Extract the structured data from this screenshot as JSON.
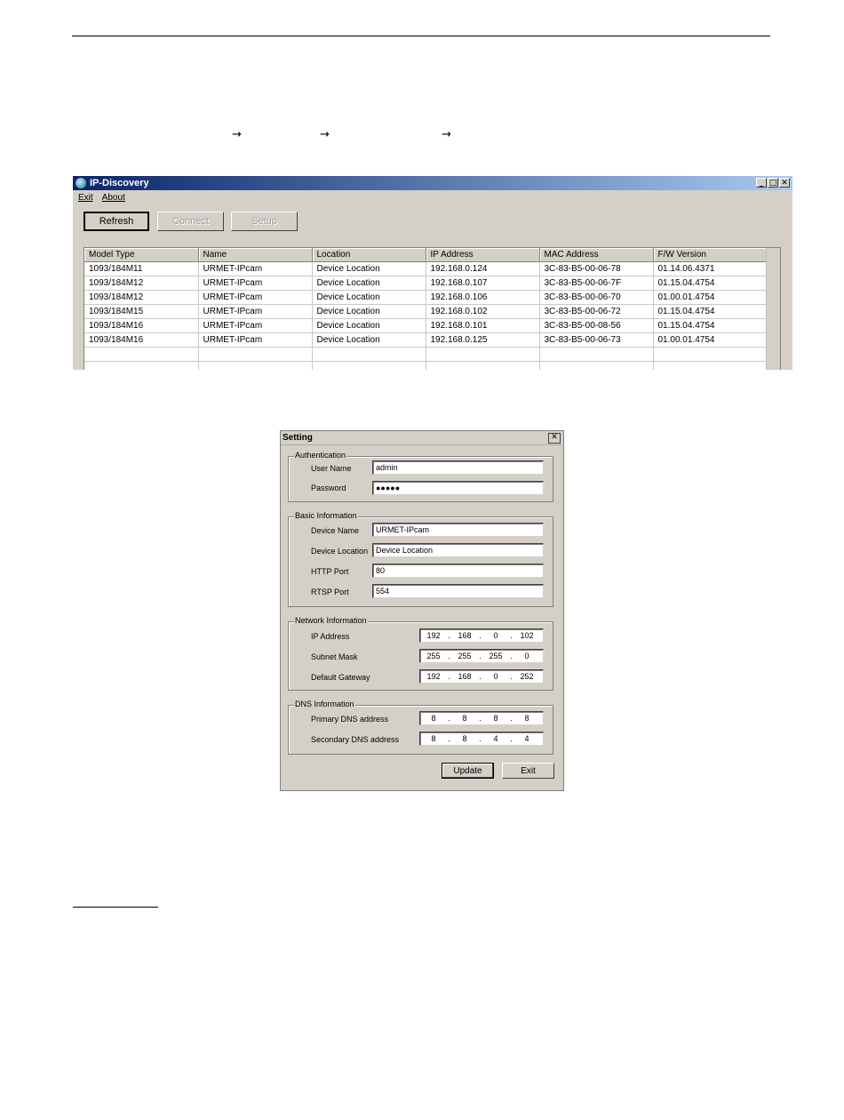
{
  "page": {
    "arrow_glyph": "→"
  },
  "discovery": {
    "title": "IP-Discovery",
    "window_buttons": {
      "minimize": "_",
      "maximize": "□",
      "close": "✕"
    },
    "menu": [
      "Exit",
      "About"
    ],
    "buttons": {
      "refresh": "Refresh",
      "connect": "Connect",
      "setup": "Setup"
    },
    "columns": [
      "Model Type",
      "Name",
      "Location",
      "IP Address",
      "MAC Address",
      "F/W Version"
    ],
    "rows": [
      [
        "1093/184M11",
        "URMET-IPcam",
        "Device Location",
        "192.168.0.124",
        "3C-83-B5-00-06-78",
        "01.14.06.4371"
      ],
      [
        "1093/184M12",
        "URMET-IPcam",
        "Device Location",
        "192.168.0.107",
        "3C-83-B5-00-06-7F",
        "01.15.04.4754"
      ],
      [
        "1093/184M12",
        "URMET-IPcam",
        "Device Location",
        "192.168.0.106",
        "3C-83-B5-00-06-70",
        "01.00.01.4754"
      ],
      [
        "1093/184M15",
        "URMET-IPcam",
        "Device Location",
        "192.168.0.102",
        "3C-83-B5-00-06-72",
        "01.15.04.4754"
      ],
      [
        "1093/184M16",
        "URMET-IPcam",
        "Device Location",
        "192.168.0.101",
        "3C-83-B5-00-08-56",
        "01.15.04.4754"
      ],
      [
        "1093/184M16",
        "URMET-IPcam",
        "Device Location",
        "192.168.0.125",
        "3C-83-B5-00-06-73",
        "01.00.01.4754"
      ]
    ]
  },
  "setting": {
    "title": "Setting",
    "close": "✕",
    "authentication": {
      "legend": "Authentication",
      "user_name_label": "User Name",
      "user_name_value": "admin",
      "password_label": "Password",
      "password_value": "●●●●●"
    },
    "basic": {
      "legend": "Basic Information",
      "device_name_label": "Device Name",
      "device_name_value": "URMET-IPcam",
      "device_location_label": "Device Location",
      "device_location_value": "Device Location",
      "http_port_label": "HTTP Port",
      "http_port_value": "80",
      "rtsp_port_label": "RTSP Port",
      "rtsp_port_value": "554"
    },
    "network": {
      "legend": "Network Information",
      "ip_label": "IP Address",
      "ip": [
        "192",
        "168",
        "0",
        "102"
      ],
      "mask_label": "Subnet Mask",
      "mask": [
        "255",
        "255",
        "255",
        "0"
      ],
      "gateway_label": "Default Gateway",
      "gateway": [
        "192",
        "168",
        "0",
        "252"
      ]
    },
    "dns": {
      "legend": "DNS Information",
      "primary_label": "Primary DNS address",
      "primary": [
        "8",
        "8",
        "8",
        "8"
      ],
      "secondary_label": "Secondary DNS address",
      "secondary": [
        "8",
        "8",
        "4",
        "4"
      ]
    },
    "buttons": {
      "update": "Update",
      "exit": "Exit"
    }
  }
}
